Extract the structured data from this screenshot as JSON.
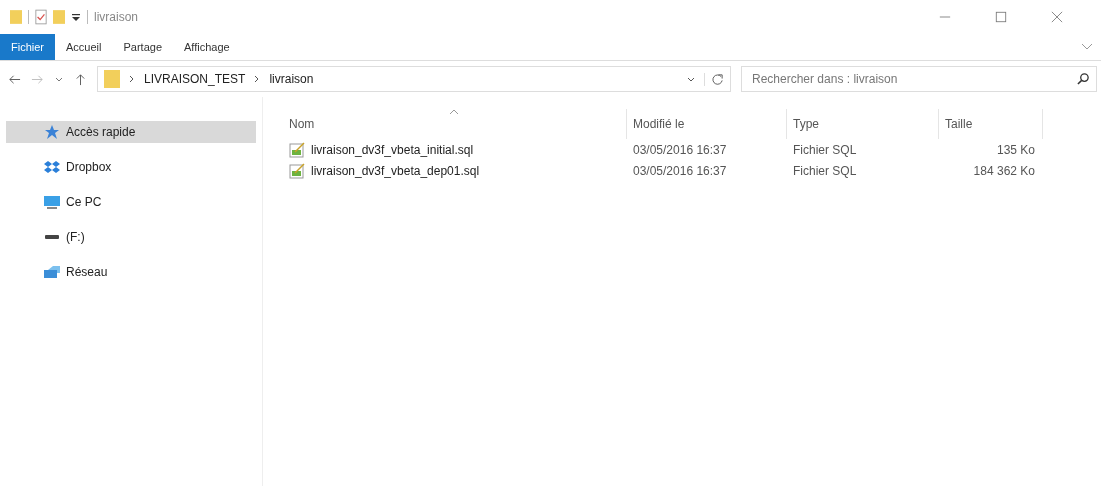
{
  "window": {
    "title": "livraison"
  },
  "ribbon_tabs": [
    {
      "label": "Fichier",
      "selected": true
    },
    {
      "label": "Accueil",
      "selected": false
    },
    {
      "label": "Partage",
      "selected": false
    },
    {
      "label": "Affichage",
      "selected": false
    }
  ],
  "address_bar": {
    "path": [
      "LIVRAISON_TEST",
      "livraison"
    ]
  },
  "search": {
    "placeholder": "Rechercher dans : livraison"
  },
  "sidebar": {
    "items": [
      {
        "label": "Accès rapide",
        "kind": "star",
        "selected": true
      },
      {
        "label": "Dropbox",
        "kind": "dropbox",
        "selected": false
      },
      {
        "label": "Ce PC",
        "kind": "pc",
        "selected": false
      },
      {
        "label": "(F:)",
        "kind": "drive",
        "selected": false
      },
      {
        "label": "Réseau",
        "kind": "network",
        "selected": false
      }
    ]
  },
  "table": {
    "columns": [
      "Nom",
      "Modifié le",
      "Type",
      "Taille"
    ],
    "rows": [
      {
        "name": "livraison_dv3f_vbeta_initial.sql",
        "modified": "03/05/2016 16:37",
        "type": "Fichier SQL",
        "size": "135 Ko"
      },
      {
        "name": "livraison_dv3f_vbeta_dep01.sql",
        "modified": "03/05/2016 16:37",
        "type": "Fichier SQL",
        "size": "184 362 Ko"
      }
    ]
  }
}
